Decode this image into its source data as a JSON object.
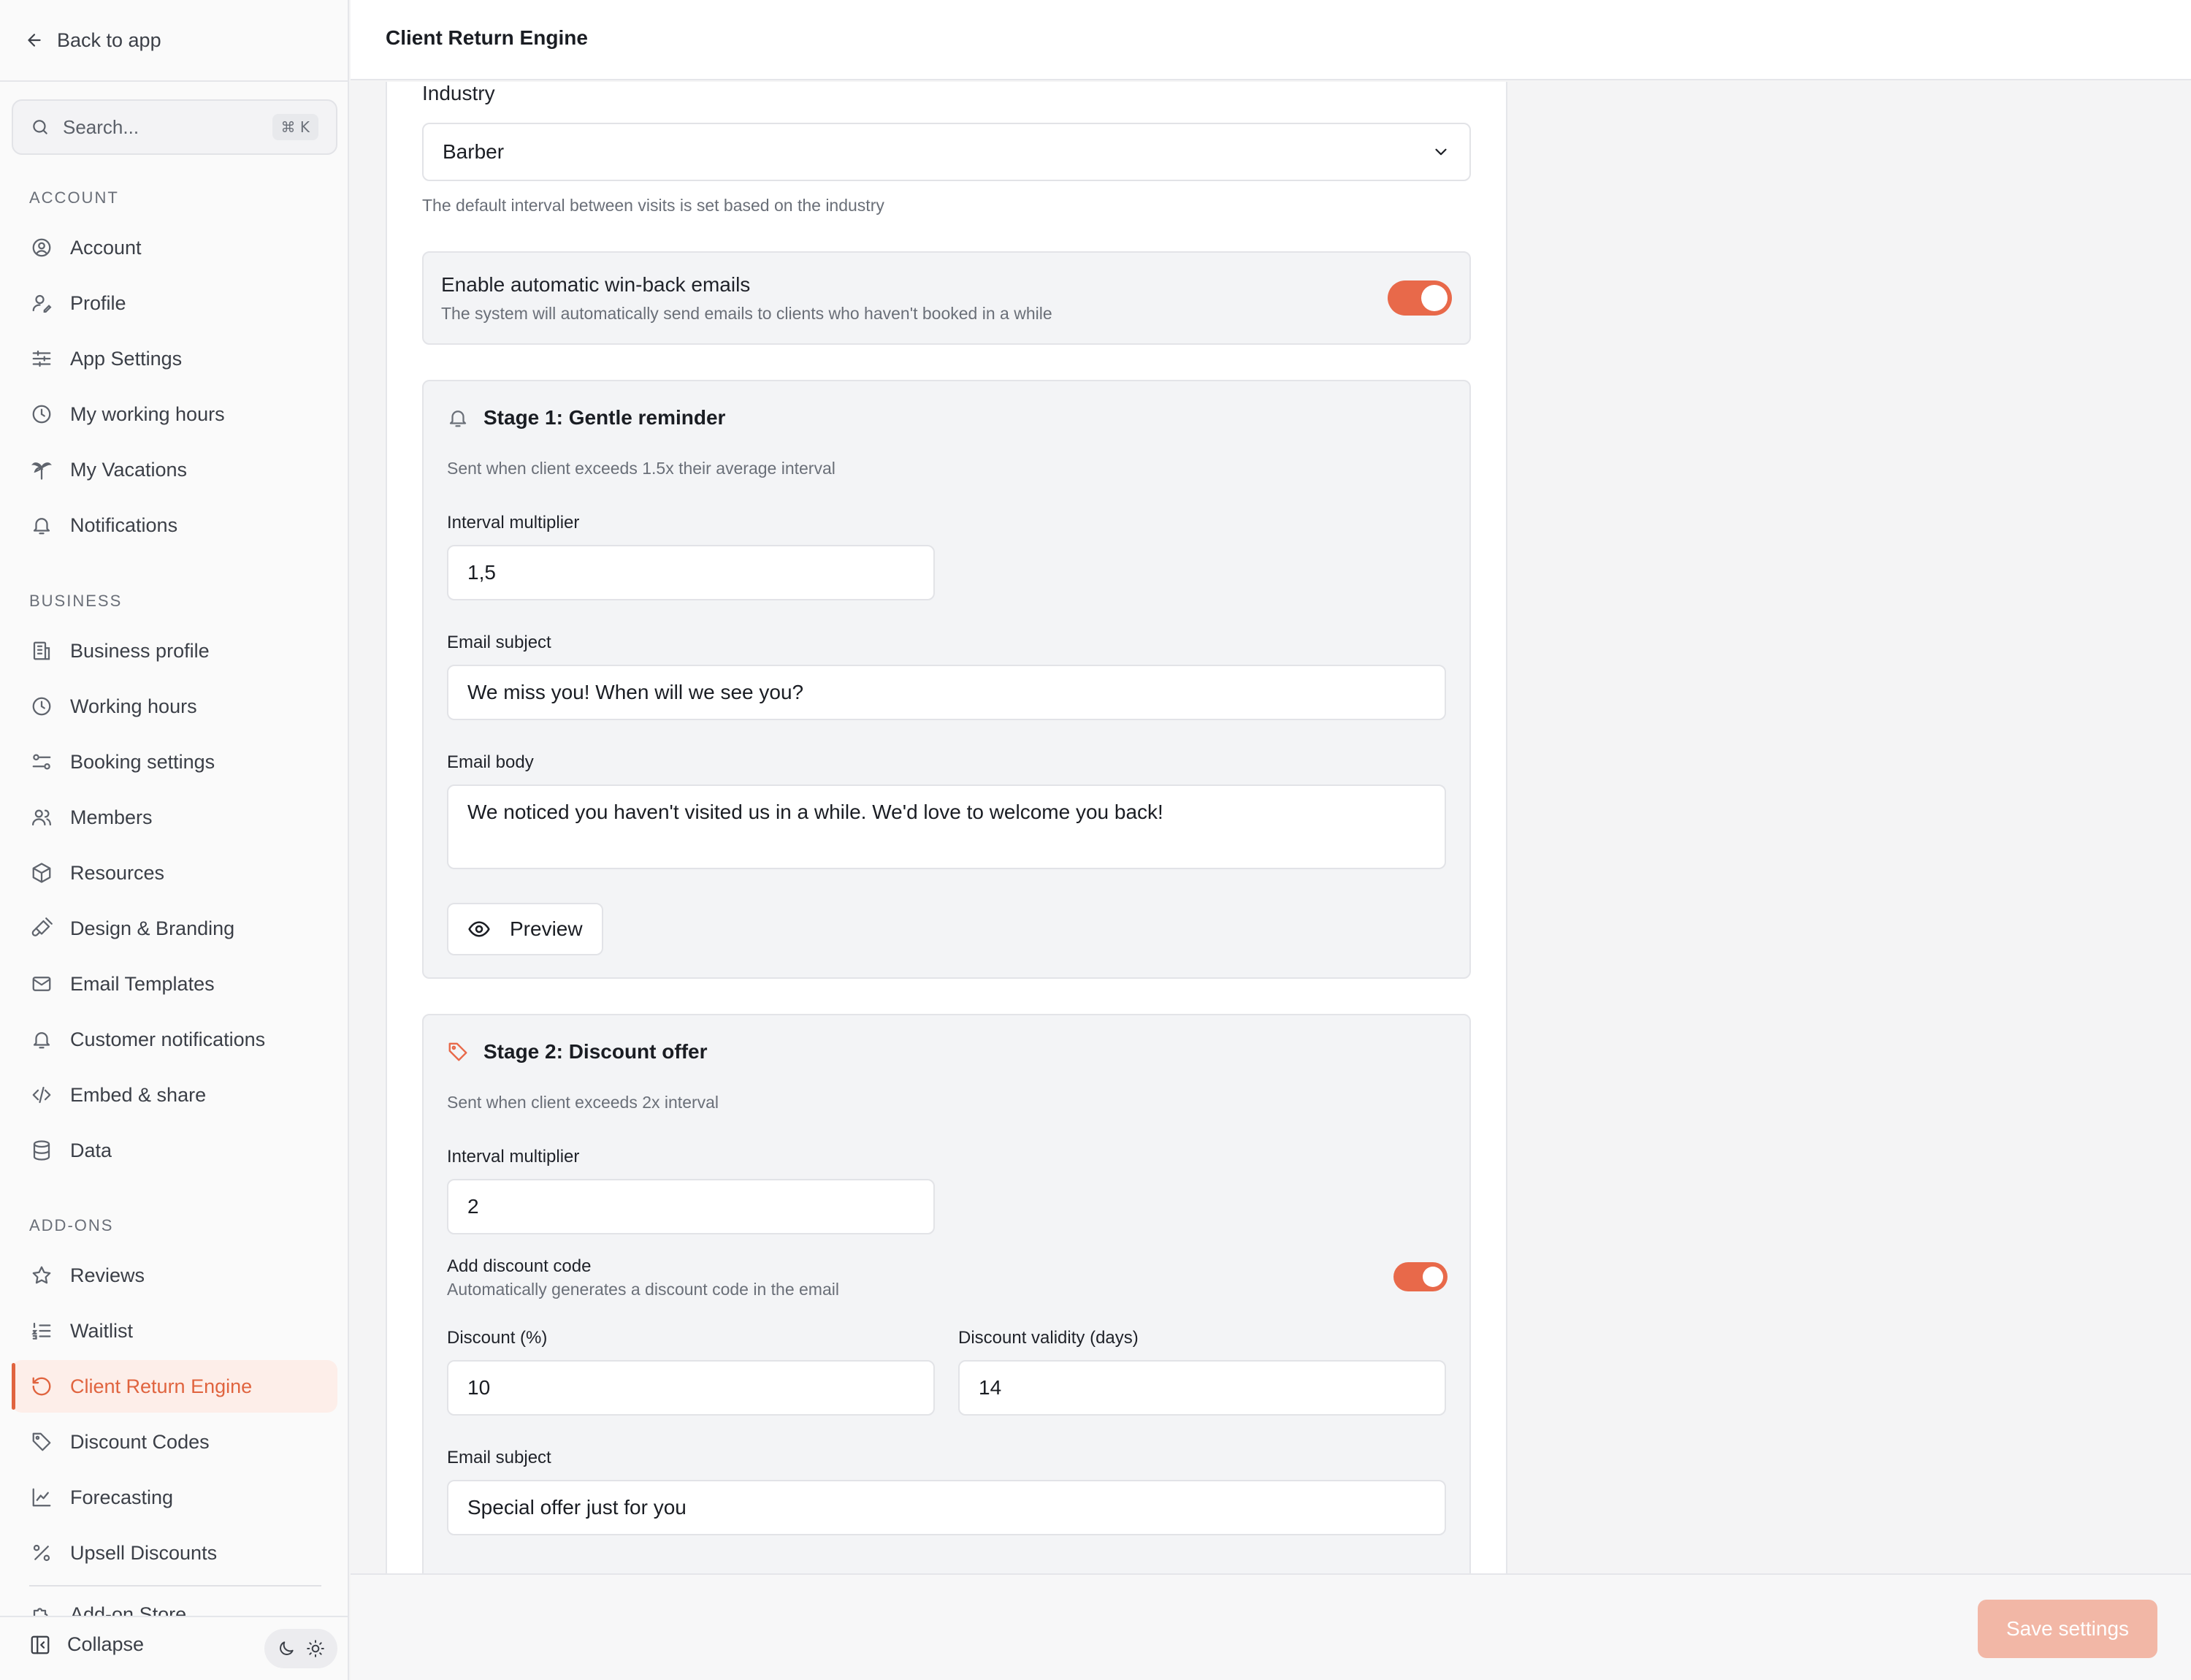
{
  "app": {
    "title": "Client Return Engine",
    "back_label": "Back to app"
  },
  "search": {
    "placeholder": "Search...",
    "shortcut": "⌘ K"
  },
  "sidebar": {
    "sections": {
      "account": "ACCOUNT",
      "business": "BUSINESS",
      "addons": "ADD-ONS"
    },
    "account_items": [
      {
        "label": "Account",
        "icon": "user-circle-icon"
      },
      {
        "label": "Profile",
        "icon": "user-pen-icon"
      },
      {
        "label": "App Settings",
        "icon": "sliders-icon"
      },
      {
        "label": "My working hours",
        "icon": "clock-icon"
      },
      {
        "label": "My Vacations",
        "icon": "palm-tree-icon"
      },
      {
        "label": "Notifications",
        "icon": "bell-icon"
      }
    ],
    "business_items": [
      {
        "label": "Business profile",
        "icon": "building-icon"
      },
      {
        "label": "Working hours",
        "icon": "clock-icon"
      },
      {
        "label": "Booking settings",
        "icon": "settings-toggle-icon"
      },
      {
        "label": "Members",
        "icon": "users-icon"
      },
      {
        "label": "Resources",
        "icon": "box-icon"
      },
      {
        "label": "Design & Branding",
        "icon": "brush-icon"
      },
      {
        "label": "Email Templates",
        "icon": "mail-icon"
      },
      {
        "label": "Customer notifications",
        "icon": "bell-icon"
      },
      {
        "label": "Embed & share",
        "icon": "code-icon"
      },
      {
        "label": "Data",
        "icon": "database-icon"
      }
    ],
    "addon_items": [
      {
        "label": "Reviews",
        "icon": "star-icon"
      },
      {
        "label": "Waitlist",
        "icon": "list-ordered-icon"
      },
      {
        "label": "Client Return Engine",
        "icon": "rotate-ccw-icon",
        "active": true
      },
      {
        "label": "Discount Codes",
        "icon": "tag-icon"
      },
      {
        "label": "Forecasting",
        "icon": "chart-line-icon"
      },
      {
        "label": "Upsell Discounts",
        "icon": "percent-icon"
      },
      {
        "label": "Add-on Store",
        "icon": "puzzle-icon"
      }
    ],
    "collapse_label": "Collapse"
  },
  "form": {
    "industry": {
      "label": "Industry",
      "value": "Barber",
      "hint": "The default interval between visits is set based on the industry"
    },
    "winback": {
      "title": "Enable automatic win-back emails",
      "description": "The system will automatically send emails to clients who haven't booked in a while",
      "enabled": true
    },
    "stage1": {
      "title": "Stage 1: Gentle reminder",
      "description": "Sent when client exceeds 1.5x their average interval",
      "interval_label": "Interval multiplier",
      "interval_value": "1,5",
      "subject_label": "Email subject",
      "subject_value": "We miss you! When will we see you?",
      "body_label": "Email body",
      "body_value": "We noticed you haven't visited us in a while. We'd love to welcome you back!",
      "preview_label": "Preview"
    },
    "stage2": {
      "title": "Stage 2: Discount offer",
      "description": "Sent when client exceeds 2x interval",
      "interval_label": "Interval multiplier",
      "interval_value": "2",
      "discount_code_label": "Add discount code",
      "discount_code_hint": "Automatically generates a discount code in the email",
      "discount_code_enabled": true,
      "discount_label": "Discount (%)",
      "discount_value": "10",
      "validity_label": "Discount validity (days)",
      "validity_value": "14",
      "subject_label": "Email subject",
      "subject_value": "Special offer just for you"
    }
  },
  "footer": {
    "save_label": "Save settings"
  },
  "colors": {
    "accent": "#e8694a",
    "accent_soft": "#fdeee9",
    "save_disabled": "#f2b7a6"
  }
}
